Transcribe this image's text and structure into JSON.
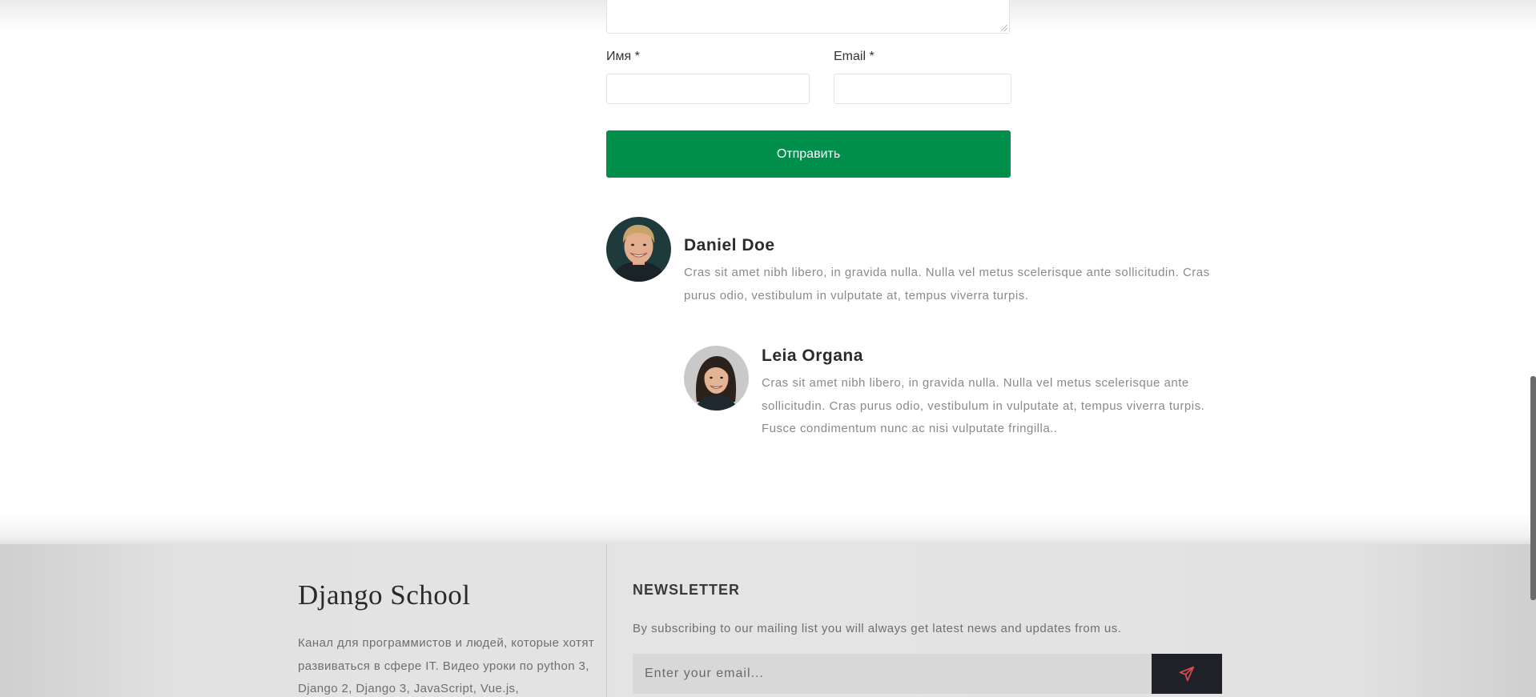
{
  "form": {
    "name_label": "Имя *",
    "email_label": "Email *",
    "name_value": "",
    "email_value": "",
    "submit_label": "Отправить"
  },
  "comments": [
    {
      "author": "Daniel Doe",
      "text": "Cras sit amet nibh libero, in gravida nulla. Nulla vel metus scelerisque ante sollicitudin. Cras purus odio, vestibulum in vulputate at, tempus viverra turpis."
    },
    {
      "author": "Leia Organa",
      "text": "Cras sit amet nibh libero, in gravida nulla. Nulla vel metus scelerisque ante sollicitudin. Cras purus odio, vestibulum in vulputate at, tempus viverra turpis. Fusce condimentum nunc ac nisi vulputate fringilla.."
    }
  ],
  "footer": {
    "brand": "Django School",
    "about": "Канал для программистов и людей, которые хотят развиваться в сфере IT. Видео уроки по python 3, Django 2, Django 3, JavaScript, Vue.js,",
    "newsletter": {
      "heading": "NEWSLETTER",
      "description": "By subscribing to our mailing list you will always get latest news and updates from us.",
      "placeholder": "Enter your email...",
      "button_icon": "paper-plane-icon"
    }
  },
  "colors": {
    "primary_button": "#01904b",
    "newsletter_button": "#1e2127",
    "send_icon": "#e0494f"
  }
}
